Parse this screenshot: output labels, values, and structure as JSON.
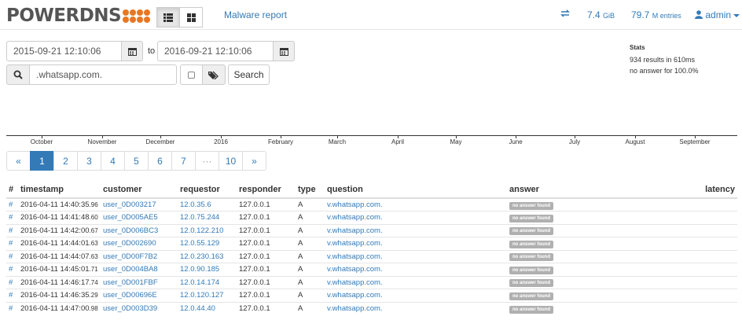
{
  "brand": {
    "name": "POWERDNS"
  },
  "nav": {
    "view_list_icon": "list-icon",
    "view_grid_icon": "grid-icon",
    "malware_report": "Malware report",
    "sync_icon": "exchange-icon",
    "size_value": "7.4",
    "size_unit": "GiB",
    "entries_value": "79.7",
    "entries_unit": "M entries",
    "user_icon": "user-icon",
    "user": "admin"
  },
  "search": {
    "from": "2015-09-21 12:10:06",
    "to_label": "to",
    "to": "2016-09-21 12:10:06",
    "query": ".whatsapp.com.",
    "submit": "Search"
  },
  "stats": {
    "title": "Stats",
    "results": "934 results in 610ms",
    "noanswer": "no answer for 100.0%"
  },
  "timeline": {
    "labels": [
      "October",
      "November",
      "December",
      "2016",
      "February",
      "March",
      "April",
      "May",
      "June",
      "July",
      "August",
      "September"
    ]
  },
  "pagination": {
    "items": [
      "«",
      "1",
      "2",
      "3",
      "4",
      "5",
      "6",
      "7",
      "···",
      "10",
      "»"
    ],
    "active": "1"
  },
  "table": {
    "headers": [
      "#",
      "timestamp",
      "customer",
      "requestor",
      "responder",
      "type",
      "question",
      "answer",
      "latency"
    ],
    "rows": [
      {
        "hash": "#",
        "ts": "2016-04-11 14:40:35",
        "ms": ".96",
        "customer": "user_0D003217",
        "requestor": "12.0.35.6",
        "responder": "127.0.0.1",
        "type": "A",
        "question": "v.whatsapp.com.",
        "answer": "no answer found"
      },
      {
        "hash": "#",
        "ts": "2016-04-11 14:41:48",
        "ms": ".60",
        "customer": "user_0D005AE5",
        "requestor": "12.0.75.244",
        "responder": "127.0.0.1",
        "type": "A",
        "question": "v.whatsapp.com.",
        "answer": "no answer found"
      },
      {
        "hash": "#",
        "ts": "2016-04-11 14:42:00",
        "ms": ".67",
        "customer": "user_0D006BC3",
        "requestor": "12.0.122.210",
        "responder": "127.0.0.1",
        "type": "A",
        "question": "v.whatsapp.com.",
        "answer": "no answer found"
      },
      {
        "hash": "#",
        "ts": "2016-04-11 14:44:01",
        "ms": ".63",
        "customer": "user_0D002690",
        "requestor": "12.0.55.129",
        "responder": "127.0.0.1",
        "type": "A",
        "question": "v.whatsapp.com.",
        "answer": "no answer found"
      },
      {
        "hash": "#",
        "ts": "2016-04-11 14:44:07",
        "ms": ".63",
        "customer": "user_0D00F7B2",
        "requestor": "12.0.230.163",
        "responder": "127.0.0.1",
        "type": "A",
        "question": "v.whatsapp.com.",
        "answer": "no answer found"
      },
      {
        "hash": "#",
        "ts": "2016-04-11 14:45:01",
        "ms": ".71",
        "customer": "user_0D004BA8",
        "requestor": "12.0.90.185",
        "responder": "127.0.0.1",
        "type": "A",
        "question": "v.whatsapp.com.",
        "answer": "no answer found"
      },
      {
        "hash": "#",
        "ts": "2016-04-11 14:46:17",
        "ms": ".74",
        "customer": "user_0D001FBF",
        "requestor": "12.0.14.174",
        "responder": "127.0.0.1",
        "type": "A",
        "question": "v.whatsapp.com.",
        "answer": "no answer found"
      },
      {
        "hash": "#",
        "ts": "2016-04-11 14:46:35",
        "ms": ".29",
        "customer": "user_0D00696E",
        "requestor": "12.0.120.127",
        "responder": "127.0.0.1",
        "type": "A",
        "question": "v.whatsapp.com.",
        "answer": "no answer found"
      },
      {
        "hash": "#",
        "ts": "2016-04-11 14:47:00",
        "ms": ".98",
        "customer": "user_0D003D39",
        "requestor": "12.0.44.40",
        "responder": "127.0.0.1",
        "type": "A",
        "question": "v.whatsapp.com.",
        "answer": "no answer found"
      }
    ]
  },
  "colors": {
    "accent": "#337ab7",
    "logo_dots": "#e87722",
    "badge": "#b0b0b0"
  }
}
